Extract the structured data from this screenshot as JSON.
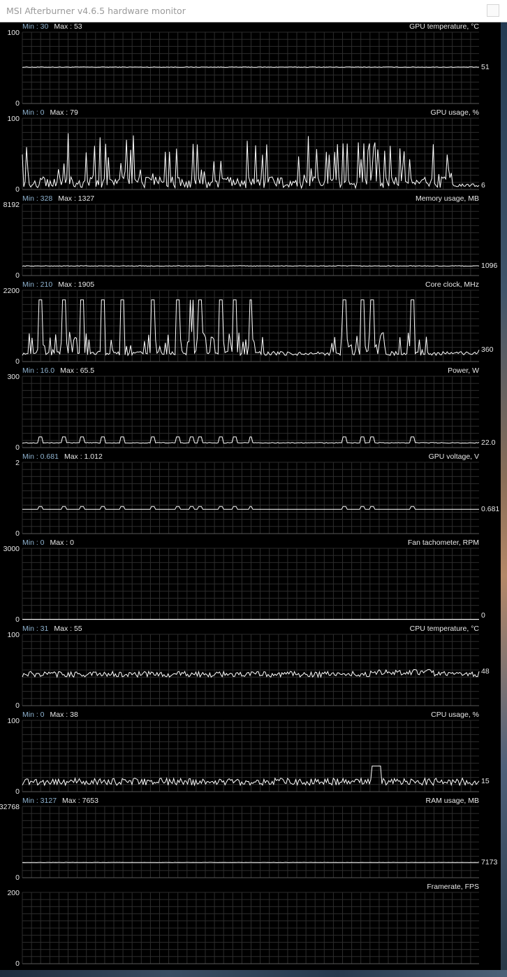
{
  "window": {
    "title": "MSI Afterburner v4.6.5 hardware monitor"
  },
  "colors": {
    "background": "#000000",
    "grid": "#2c2c2c",
    "trace": "#ffffff",
    "min_text": "#8fb3d0",
    "text": "#e8e8e8"
  },
  "graphs": [
    {
      "id": "gpu-temperature",
      "label": "GPU temperature, °C",
      "min_text": "Min : 30",
      "max_text": "Max : 53",
      "ymax": "100",
      "ymin": "0",
      "scale_max": 100,
      "current": "51",
      "current_value": 51,
      "pattern": "flat",
      "baseline": 51,
      "noise": 0.4
    },
    {
      "id": "gpu-usage",
      "label": "GPU usage, %",
      "min_text": "Min : 0",
      "max_text": "Max : 79",
      "ymax": "100",
      "ymin": "0",
      "scale_max": 100,
      "current": "6",
      "current_value": 6,
      "pattern": "noisy-spiky",
      "baseline": 10,
      "noise": 8,
      "max_value": 79
    },
    {
      "id": "memory-usage",
      "label": "Memory usage, MB",
      "min_text": "Min : 328",
      "max_text": "Max : 1327",
      "ymax": "8192",
      "ymin": "0",
      "scale_max": 8192,
      "current": "1096",
      "current_value": 1096,
      "pattern": "flat",
      "baseline": 1100,
      "noise": 40
    },
    {
      "id": "core-clock",
      "label": "Core clock, MHz",
      "min_text": "Min : 210",
      "max_text": "Max : 1905",
      "ymax": "2200",
      "ymin": "0",
      "scale_max": 2200,
      "current": "360",
      "current_value": 360,
      "pattern": "pulses",
      "baseline": 250,
      "noise": 60,
      "max_value": 1905
    },
    {
      "id": "power",
      "label": "Power, W",
      "min_text": "Min : 16.0",
      "max_text": "Max : 65.5",
      "ymax": "300",
      "ymin": "0",
      "scale_max": 300,
      "current": "22.0",
      "current_value": 22.0,
      "pattern": "small-pulses",
      "baseline": 20,
      "noise": 1.5,
      "max_value": 45
    },
    {
      "id": "gpu-voltage",
      "label": "GPU voltage, V",
      "min_text": "Min : 0.681",
      "max_text": "Max : 1.012",
      "ymax": "2",
      "ymin": "0",
      "scale_max": 2,
      "current": "0.681",
      "current_value": 0.681,
      "pattern": "small-pulses",
      "baseline": 0.681,
      "noise": 0,
      "max_value": 0.76
    },
    {
      "id": "fan-tachometer",
      "label": "Fan tachometer, RPM",
      "min_text": "Min : 0",
      "max_text": "Max : 0",
      "ymax": "3000",
      "ymin": "0",
      "scale_max": 3000,
      "current": "0",
      "current_value": 0,
      "pattern": "flat",
      "baseline": 0,
      "noise": 0
    },
    {
      "id": "cpu-temperature",
      "label": "CPU temperature, °C",
      "min_text": "Min : 31",
      "max_text": "Max : 55",
      "ymax": "100",
      "ymin": "0",
      "scale_max": 100,
      "current": "48",
      "current_value": 48,
      "pattern": "noisy",
      "baseline": 44,
      "noise": 4
    },
    {
      "id": "cpu-usage",
      "label": "CPU usage, %",
      "min_text": "Min : 0",
      "max_text": "Max : 38",
      "ymax": "100",
      "ymin": "0",
      "scale_max": 100,
      "current": "15",
      "current_value": 15,
      "pattern": "noisy",
      "baseline": 14,
      "noise": 5
    },
    {
      "id": "ram-usage",
      "label": "RAM usage, MB",
      "min_text": "Min : 3127",
      "max_text": "Max : 7653",
      "ymax": "32768",
      "ymin": "0",
      "scale_max": 32768,
      "current": "7173",
      "current_value": 7173,
      "pattern": "flat",
      "baseline": 7000,
      "noise": 60
    },
    {
      "id": "framerate",
      "label": "Framerate, FPS",
      "min_text": "",
      "max_text": "",
      "ymax": "200",
      "ymin": "0",
      "scale_max": 200,
      "current": "",
      "current_value": null,
      "pattern": "none"
    }
  ],
  "pulse_positions": [
    0.04,
    0.09,
    0.13,
    0.175,
    0.22,
    0.285,
    0.34,
    0.37,
    0.39,
    0.435,
    0.465,
    0.5,
    0.705,
    0.745,
    0.765,
    0.855
  ]
}
